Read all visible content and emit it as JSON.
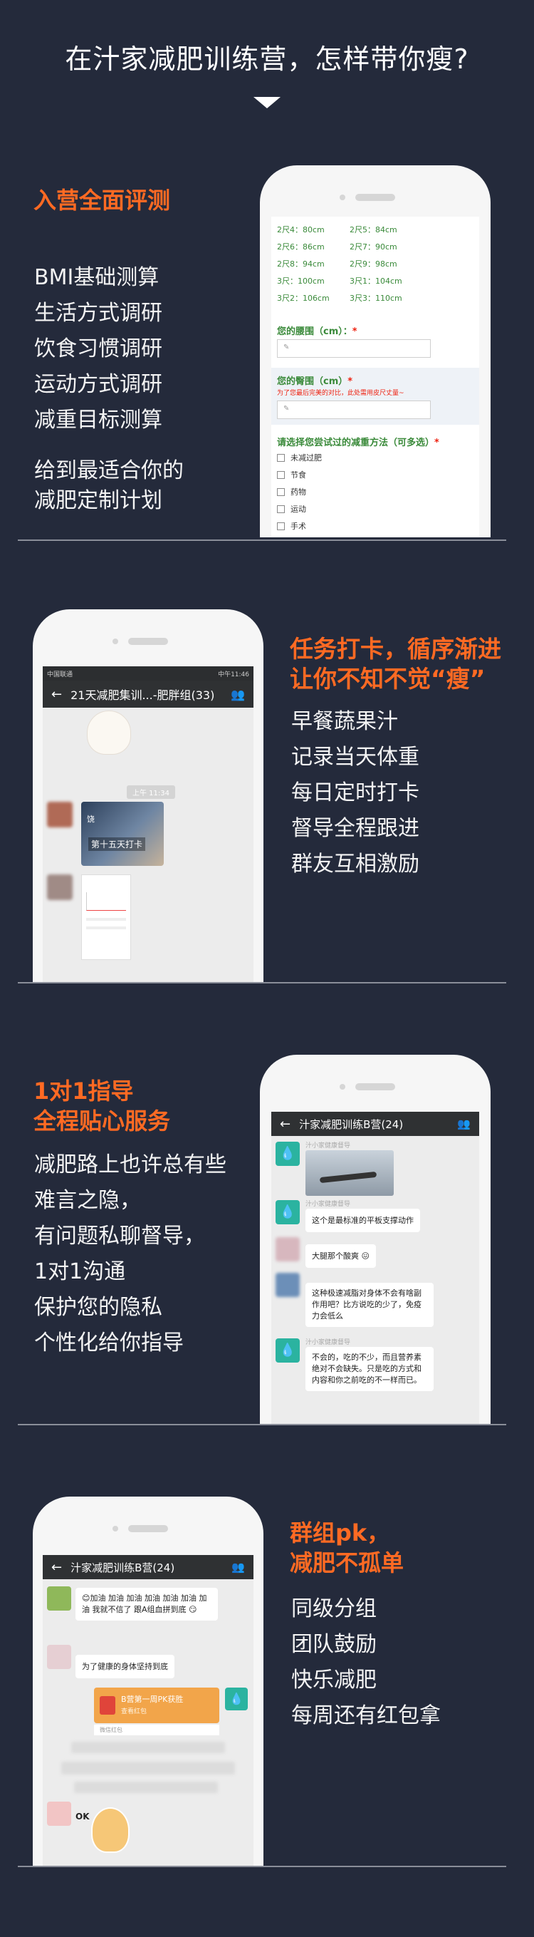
{
  "header": {
    "title": "在汁家减肥训练营，怎样带你瘦?"
  },
  "section1": {
    "heading": "入营全面评测",
    "items": [
      "BMI基础测算",
      "生活方式调研",
      "饮食习惯调研",
      "运动方式调研",
      "减重目标测算"
    ],
    "summary": [
      "给到最适合你的",
      "减肥定制计划"
    ],
    "form": {
      "sizes": [
        [
          "2尺4：80cm",
          "2尺5：84cm"
        ],
        [
          "2尺6：86cm",
          "2尺7：90cm"
        ],
        [
          "2尺8：94cm",
          "2尺9：98cm"
        ],
        [
          "3尺：100cm",
          "3尺1：104cm"
        ],
        [
          "3尺2：106cm",
          "3尺3：110cm"
        ]
      ],
      "waist_label": "您的腰围（cm）：",
      "required_mark": "*",
      "hip_label": "您的臀围（cm）",
      "hip_note": "为了您最后完美的对比，此处需用皮尺丈量~",
      "methods_label": "请选择您尝试过的减重方法（可多选）",
      "methods": [
        "未减过肥",
        "节食",
        "药物",
        "运动",
        "手术"
      ]
    }
  },
  "section2": {
    "heading": [
      "任务打卡，循序渐进",
      "让你不知不觉“瘦”"
    ],
    "items": [
      "早餐蔬果汁",
      "记录当天体重",
      "每日定时打卡",
      "督导全程跟进",
      "群友互相激励"
    ],
    "chat": {
      "status_left": "中国联通",
      "status_right": "中午11:46",
      "title": "21天减肥集训...-肥胖组(33)",
      "time": "上午 11:34",
      "photo_label": "第十五天打卡",
      "photo_tag": "饶"
    }
  },
  "section3": {
    "heading": [
      "1对1指导",
      "全程贴心服务"
    ],
    "items": [
      "减肥路上也许总有些",
      "难言之隐，",
      "有问题私聊督导，",
      "1对1沟通",
      "保护您的隐私",
      "个性化给你指导"
    ],
    "chat": {
      "title": "汁家减肥训练B营(24)",
      "admin_name": "汁小家健康督导",
      "msg1": "这个是最标准的平板支撑动作",
      "msg2": "大腿那个酸爽",
      "msg3": "这种极速减脂对身体不会有啥副作用吧？比方说吃的少了，免疫力会低么",
      "msg4": "不会的，吃的不少，而且营养素绝对不会缺失。只是吃的方式和内容和你之前吃的不一样而已。"
    }
  },
  "section4": {
    "heading": [
      "群组pk，",
      "减肥不孤单"
    ],
    "items": [
      "同级分组",
      "团队鼓励",
      "快乐减肥",
      "每周还有红包拿"
    ],
    "chat": {
      "title": "汁家减肥训练B营(24)",
      "msg1": "加油 加油 加油 加油 加油 加油 加油 我就不信了 跟A组血拼到底",
      "msg2": "为了健康的身体坚持到底",
      "packet_title": "B营第一周PK获胜",
      "packet_sub": "查看红包",
      "packet_footer": "微信红包",
      "sticker_text": "OK"
    }
  }
}
